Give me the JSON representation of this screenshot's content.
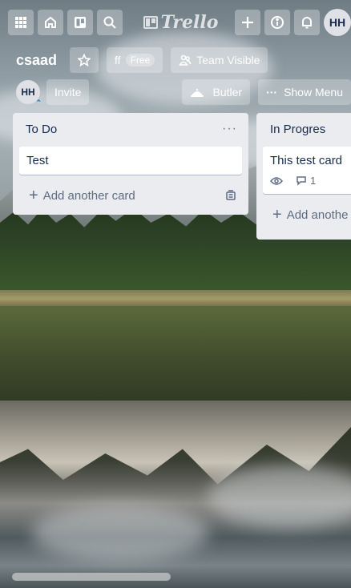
{
  "header": {
    "logo_text": "Trello",
    "avatar_initials": "HH"
  },
  "board": {
    "name": "csaad",
    "org_short": "ff",
    "plan_badge": "Free",
    "visibility_label": "Team Visible",
    "member_initials": "HH",
    "invite_label": "Invite",
    "butler_label": "Butler",
    "show_menu_label": "Show Menu"
  },
  "lists": [
    {
      "title": "To Do",
      "cards": [
        {
          "title": "Test"
        }
      ],
      "add_card_label": "Add another card"
    },
    {
      "title": "In Progres",
      "cards": [
        {
          "title": "This test card",
          "comment_count": "1"
        }
      ],
      "add_card_label": "Add anothe"
    }
  ],
  "scrollbar": {
    "position_fraction": 0.0
  },
  "colors": {
    "list_bg": "#ebecf0",
    "card_text": "#172b4d",
    "muted_text": "#5e6c84",
    "header_button_bg": "rgba(255,255,255,0.3)"
  },
  "icons": [
    "apps-grid-icon",
    "home-icon",
    "boards-icon",
    "search-icon",
    "plus-icon",
    "info-icon",
    "bell-icon",
    "star-icon",
    "team-icon",
    "butler-icon",
    "more-dots-icon",
    "eye-icon",
    "comment-icon",
    "card-template-icon"
  ]
}
